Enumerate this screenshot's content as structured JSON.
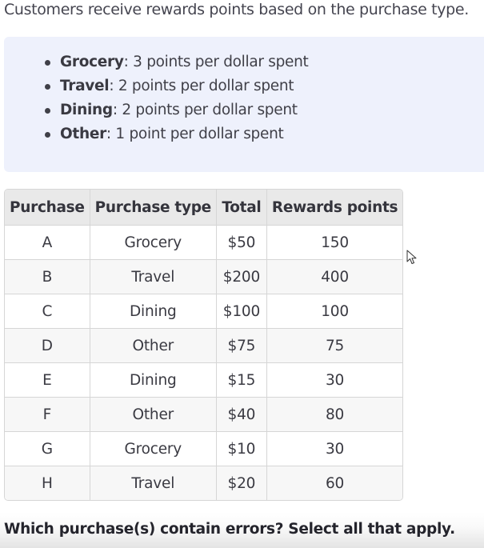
{
  "intro": {
    "text": "Customers receive rewards points based on the purchase type."
  },
  "rules": [
    {
      "type": "Grocery",
      "rate": ": 3 points per dollar spent"
    },
    {
      "type": "Travel",
      "rate": ": 2 points per dollar spent"
    },
    {
      "type": "Dining",
      "rate": ": 2 points per dollar spent"
    },
    {
      "type": "Other",
      "rate": ": 1 point per dollar spent"
    }
  ],
  "table": {
    "headers": [
      "Purchase",
      "Purchase type",
      "Total",
      "Rewards points"
    ],
    "rows": [
      [
        "A",
        "Grocery",
        "$50",
        "150"
      ],
      [
        "B",
        "Travel",
        "$200",
        "400"
      ],
      [
        "C",
        "Dining",
        "$100",
        "100"
      ],
      [
        "D",
        "Other",
        "$75",
        "75"
      ],
      [
        "E",
        "Dining",
        "$15",
        "30"
      ],
      [
        "F",
        "Other",
        "$40",
        "80"
      ],
      [
        "G",
        "Grocery",
        "$10",
        "30"
      ],
      [
        "H",
        "Travel",
        "$20",
        "60"
      ]
    ]
  },
  "question": {
    "text": "Which purchase(s) contain errors? Select all that apply."
  },
  "colors": {
    "rules_background": "#eef1fc",
    "header_background": "#e9e9e9",
    "stripe_background": "#f7f7f7",
    "border": "#d6d6d6"
  },
  "icons": {
    "cursor": "mouse-pointer-icon"
  }
}
